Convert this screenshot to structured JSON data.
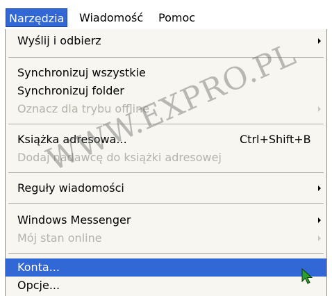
{
  "menubar": {
    "items": [
      {
        "label": "Narzędzia",
        "active": true
      },
      {
        "label": "Wiadomość",
        "active": false
      },
      {
        "label": "Pomoc",
        "active": false
      }
    ]
  },
  "menu": {
    "items": [
      {
        "label": "Wyślij i odbierz",
        "submenu": true,
        "disabled": false
      },
      {
        "label": "Synchronizuj wszystkie",
        "submenu": false,
        "disabled": false
      },
      {
        "label": "Synchronizuj folder",
        "submenu": false,
        "disabled": false
      },
      {
        "label": "Oznacz dla trybu offline",
        "submenu": true,
        "disabled": true
      },
      {
        "label": "Książka adresowa...",
        "shortcut": "Ctrl+Shift+B",
        "disabled": false
      },
      {
        "label": "Dodaj nadawcę do książki adresowej",
        "disabled": true
      },
      {
        "label": "Reguły wiadomości",
        "submenu": true,
        "disabled": false
      },
      {
        "label": "Windows Messenger",
        "submenu": true,
        "disabled": false
      },
      {
        "label": "Mój stan online",
        "submenu": true,
        "disabled": true
      },
      {
        "label": "Konta...",
        "selected": true
      },
      {
        "label": "Opcje...",
        "disabled": false
      }
    ]
  },
  "watermark": "WWW.EXPRO.PL",
  "colors": {
    "highlight": "#3168d5",
    "menu_bg": "#f7f6f1",
    "disabled_text": "#b4b2aa",
    "cursor": "#2f9e2f"
  }
}
